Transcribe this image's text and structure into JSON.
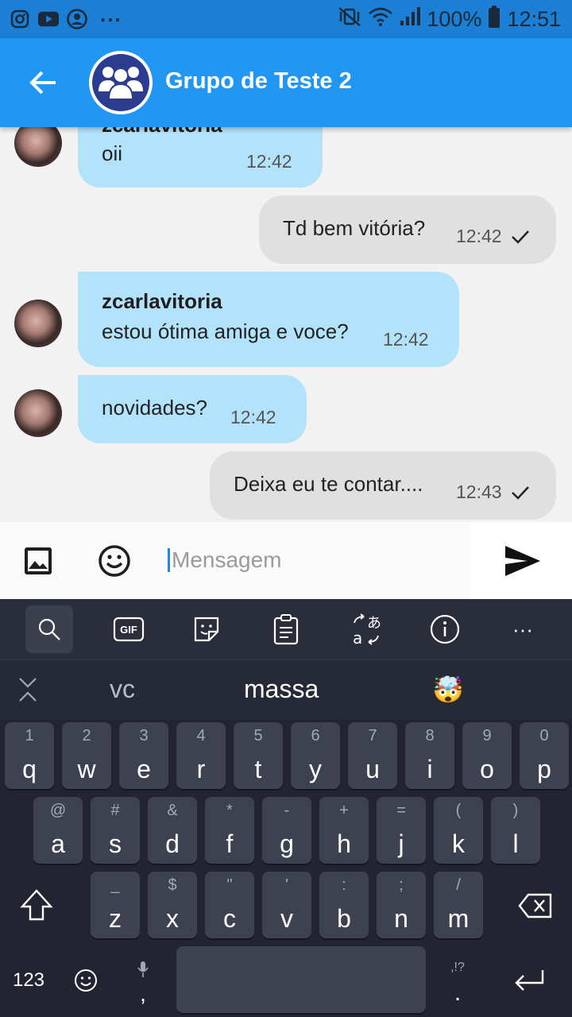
{
  "status_bar": {
    "battery": "100%",
    "time": "12:51",
    "left_icons": [
      "instagram-icon",
      "youtube-icon",
      "account-icon",
      "more-icon"
    ],
    "right_icons": [
      "vibrate-icon",
      "wifi-icon",
      "signal-icon",
      "battery-icon"
    ]
  },
  "header": {
    "title": "Grupo de Teste 2",
    "back_icon": "arrow-left-icon",
    "avatar_icon": "group-icon"
  },
  "messages": [
    {
      "direction": "incoming",
      "sender": "zcarlavitoria",
      "text": "oii",
      "time": "12:42"
    },
    {
      "direction": "outgoing",
      "text": "Td bem vitória?",
      "time": "12:42",
      "status": "sent"
    },
    {
      "direction": "incoming",
      "sender": "zcarlavitoria",
      "text": "estou ótima amiga e voce?",
      "time": "12:42"
    },
    {
      "direction": "incoming",
      "text": "novidades?",
      "time": "12:42"
    },
    {
      "direction": "outgoing",
      "text": "Deixa eu te contar....",
      "time": "12:43",
      "status": "sent"
    }
  ],
  "composer": {
    "placeholder": "Mensagem",
    "image_icon": "image-icon",
    "emoji_icon": "emoji-icon",
    "send_icon": "send-icon"
  },
  "keyboard": {
    "toolbar": [
      "search-icon",
      "gif-icon",
      "sticker-icon",
      "clipboard-icon",
      "translate-icon",
      "info-icon",
      "more-icon"
    ],
    "gif_label": "GIF",
    "more_label": "···",
    "suggestions": [
      "vc",
      "massa",
      "🤯"
    ],
    "row1": [
      {
        "k": "q",
        "s": "1"
      },
      {
        "k": "w",
        "s": "2"
      },
      {
        "k": "e",
        "s": "3"
      },
      {
        "k": "r",
        "s": "4"
      },
      {
        "k": "t",
        "s": "5"
      },
      {
        "k": "y",
        "s": "6"
      },
      {
        "k": "u",
        "s": "7"
      },
      {
        "k": "i",
        "s": "8"
      },
      {
        "k": "o",
        "s": "9"
      },
      {
        "k": "p",
        "s": "0"
      }
    ],
    "row2": [
      {
        "k": "a",
        "s": "@"
      },
      {
        "k": "s",
        "s": "#"
      },
      {
        "k": "d",
        "s": "&"
      },
      {
        "k": "f",
        "s": "*"
      },
      {
        "k": "g",
        "s": "-"
      },
      {
        "k": "h",
        "s": "+"
      },
      {
        "k": "j",
        "s": "="
      },
      {
        "k": "k",
        "s": "("
      },
      {
        "k": "l",
        "s": ")"
      }
    ],
    "row3": [
      {
        "k": "z",
        "s": "_"
      },
      {
        "k": "x",
        "s": "$"
      },
      {
        "k": "c",
        "s": "\""
      },
      {
        "k": "v",
        "s": "'"
      },
      {
        "k": "b",
        "s": ":"
      },
      {
        "k": "n",
        "s": ";"
      },
      {
        "k": "m",
        "s": "/"
      }
    ],
    "numbers_label": "123",
    "comma": ",",
    "period": ".",
    "period_sub": ",!?"
  }
}
